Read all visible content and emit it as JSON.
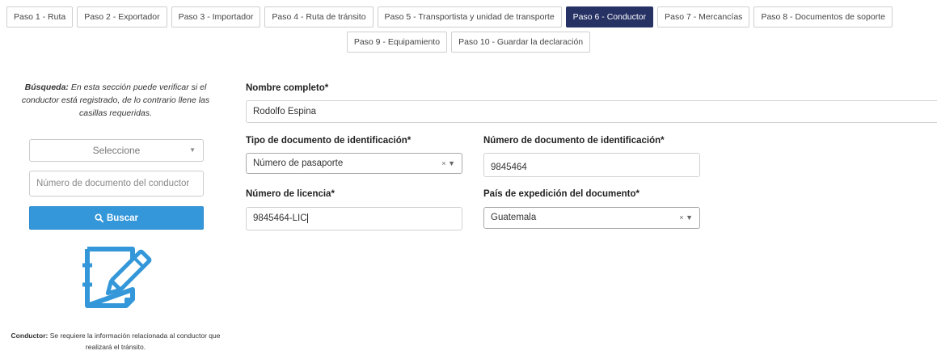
{
  "steps_row1": [
    {
      "label": "Paso 1 - Ruta",
      "active": false
    },
    {
      "label": "Paso 2 - Exportador",
      "active": false
    },
    {
      "label": "Paso 3 - Importador",
      "active": false
    },
    {
      "label": "Paso 4 - Ruta de tránsito",
      "active": false
    },
    {
      "label": "Paso 5 - Transportista y unidad de transporte",
      "active": false
    },
    {
      "label": "Paso 6 - Conductor",
      "active": true
    },
    {
      "label": "Paso 7 - Mercancías",
      "active": false
    },
    {
      "label": "Paso 8 - Documentos de soporte",
      "active": false
    }
  ],
  "steps_row2": [
    {
      "label": "Paso 9 - Equipamiento",
      "active": false
    },
    {
      "label": "Paso 10 - Guardar la declaración",
      "active": false
    }
  ],
  "search": {
    "intro_bold": "Búsqueda:",
    "intro_text": " En esta sección puede verificar si el conductor está registrado, de lo contrario llene las casillas requeridas.",
    "select_value": "Seleccione",
    "doc_placeholder": "Número de documento del conductor",
    "button_label": "Buscar"
  },
  "note": {
    "bold": "Conductor:",
    "text": " Se requiere la información relacionada al conductor que realizará el tránsito."
  },
  "form": {
    "full_name_label": "Nombre completo*",
    "full_name_value": "Rodolfo Espina",
    "id_type_label": "Tipo de documento de identificación*",
    "id_type_value": "Número de pasaporte",
    "id_number_label": "Número de documento de identificación*",
    "id_number_value": "9845464",
    "license_label": "Número de licencia*",
    "license_value": "9845464-LIC",
    "country_label": "País de expedición del documento*",
    "country_value": "Guatemala"
  },
  "colors": {
    "active_tab": "#263264",
    "primary_button": "#3497d9",
    "icon": "#3497d9"
  },
  "icons": {
    "search": "search-icon",
    "document_edit": "document-pencil-icon",
    "clear": "clear-icon",
    "dropdown": "chevron-down-icon"
  }
}
